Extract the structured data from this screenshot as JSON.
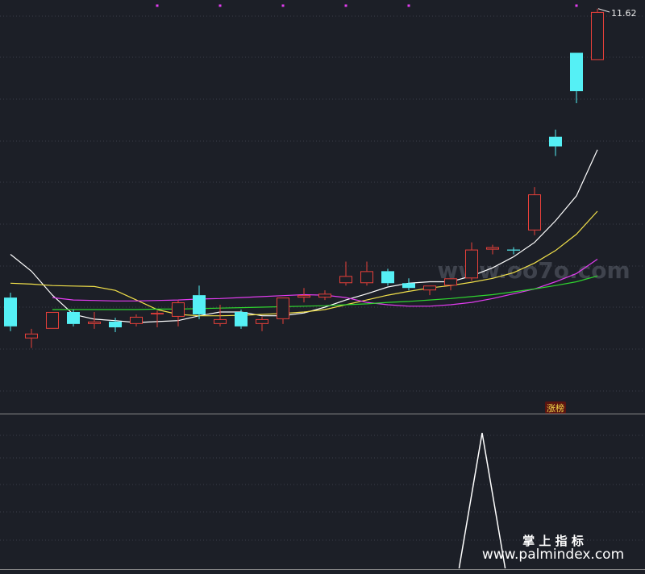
{
  "colors": {
    "background": "#1c1f27",
    "grid": "#3a3e4a",
    "separator": "#8a8a8a",
    "up_candle": "#e8403a",
    "down_candle": "#55f0f5",
    "ma_white": "#ffffff",
    "ma_yellow": "#f2e14a",
    "ma_magenta": "#e23cf0",
    "ma_green": "#2fd62f",
    "indicator_line": "#ffffff",
    "marker_dots": "#e23cf0",
    "badge_bg": "#5a1410",
    "badge_text": "#f4d94a"
  },
  "chart_data": [
    {
      "type": "candlestick",
      "panel": "price",
      "ylim": [
        3.2,
        11.8
      ],
      "max_label": "11.62",
      "candles": [
        {
          "o": 5.6,
          "h": 5.7,
          "l": 4.9,
          "c": 5.0
        },
        {
          "o": 4.75,
          "h": 4.95,
          "l": 4.55,
          "c": 4.85
        },
        {
          "o": 4.95,
          "h": 5.3,
          "l": 4.95,
          "c": 5.3
        },
        {
          "o": 5.3,
          "h": 5.35,
          "l": 5.0,
          "c": 5.05
        },
        {
          "o": 5.05,
          "h": 5.3,
          "l": 4.95,
          "c": 5.1
        },
        {
          "o": 5.1,
          "h": 5.18,
          "l": 4.88,
          "c": 4.98
        },
        {
          "o": 5.05,
          "h": 5.25,
          "l": 5.0,
          "c": 5.2
        },
        {
          "o": 5.25,
          "h": 5.32,
          "l": 4.98,
          "c": 5.28
        },
        {
          "o": 5.2,
          "h": 5.55,
          "l": 5.0,
          "c": 5.5
        },
        {
          "o": 5.65,
          "h": 5.85,
          "l": 5.15,
          "c": 5.25
        },
        {
          "o": 5.05,
          "h": 5.45,
          "l": 5.0,
          "c": 5.15
        },
        {
          "o": 5.3,
          "h": 5.35,
          "l": 4.95,
          "c": 5.0
        },
        {
          "o": 5.05,
          "h": 5.2,
          "l": 4.9,
          "c": 5.15
        },
        {
          "o": 5.15,
          "h": 5.6,
          "l": 5.05,
          "c": 5.6
        },
        {
          "o": 5.6,
          "h": 5.8,
          "l": 5.5,
          "c": 5.65
        },
        {
          "o": 5.6,
          "h": 5.75,
          "l": 5.55,
          "c": 5.68
        },
        {
          "o": 5.9,
          "h": 6.35,
          "l": 5.85,
          "c": 6.05
        },
        {
          "o": 5.9,
          "h": 6.35,
          "l": 5.85,
          "c": 6.15
        },
        {
          "o": 6.15,
          "h": 6.2,
          "l": 5.85,
          "c": 5.9
        },
        {
          "o": 5.9,
          "h": 6.0,
          "l": 5.75,
          "c": 5.8
        },
        {
          "o": 5.75,
          "h": 5.85,
          "l": 5.65,
          "c": 5.85
        },
        {
          "o": 5.85,
          "h": 6.0,
          "l": 5.75,
          "c": 6.0
        },
        {
          "o": 6.0,
          "h": 6.75,
          "l": 5.95,
          "c": 6.6
        },
        {
          "o": 6.6,
          "h": 6.7,
          "l": 6.5,
          "c": 6.65
        },
        {
          "o": 6.6,
          "h": 6.65,
          "l": 6.5,
          "c": 6.58
        },
        {
          "o": 7.0,
          "h": 7.9,
          "l": 6.9,
          "c": 7.75
        },
        {
          "o": 8.95,
          "h": 9.1,
          "l": 8.55,
          "c": 8.75
        },
        {
          "o": 10.7,
          "h": 10.7,
          "l": 9.65,
          "c": 9.9
        },
        {
          "o": 10.55,
          "h": 11.62,
          "l": 10.55,
          "c": 11.55
        }
      ],
      "ma_series": [
        {
          "color_key": "ma_white",
          "values": [
            6.5,
            6.15,
            5.65,
            5.25,
            5.15,
            5.12,
            5.08,
            5.1,
            5.12,
            5.22,
            5.3,
            5.3,
            5.22,
            5.22,
            5.28,
            5.4,
            5.55,
            5.68,
            5.82,
            5.9,
            5.93,
            5.93,
            6.05,
            6.22,
            6.45,
            6.75,
            7.2,
            7.72,
            8.68
          ]
        },
        {
          "color_key": "ma_yellow",
          "values": [
            5.9,
            5.88,
            5.85,
            5.84,
            5.83,
            5.75,
            5.55,
            5.35,
            5.25,
            5.22,
            5.22,
            5.23,
            5.25,
            5.27,
            5.3,
            5.35,
            5.45,
            5.55,
            5.65,
            5.73,
            5.8,
            5.85,
            5.92,
            6.0,
            6.12,
            6.32,
            6.58,
            6.92,
            7.4
          ]
        },
        {
          "color_key": "ma_magenta",
          "values": [
            null,
            null,
            5.6,
            5.55,
            5.54,
            5.53,
            5.53,
            5.54,
            5.55,
            5.57,
            5.58,
            5.6,
            5.62,
            5.64,
            5.66,
            5.65,
            5.6,
            5.5,
            5.45,
            5.42,
            5.42,
            5.45,
            5.5,
            5.58,
            5.68,
            5.78,
            5.93,
            6.1,
            6.4
          ]
        },
        {
          "color_key": "ma_green",
          "values": [
            null,
            null,
            5.35,
            5.35,
            5.35,
            5.35,
            5.35,
            5.36,
            5.36,
            5.37,
            5.38,
            5.39,
            5.4,
            5.41,
            5.42,
            5.43,
            5.45,
            5.47,
            5.5,
            5.52,
            5.55,
            5.58,
            5.62,
            5.66,
            5.72,
            5.78,
            5.85,
            5.93,
            6.05
          ]
        }
      ],
      "marker_dots": [
        7,
        10,
        13,
        16,
        19,
        27
      ]
    },
    {
      "type": "line",
      "panel": "indicator",
      "ylim": [
        0,
        1
      ],
      "segments": [
        {
          "x": [
            21.4,
            22.5,
            23.6
          ],
          "y": [
            0,
            1,
            0
          ]
        }
      ],
      "badge": "涨榜",
      "badge_index": 26
    }
  ],
  "watermarks": {
    "center": "www.oo7o.com",
    "cn_title": "掌 上 指 标",
    "url": "www.palmindex.com"
  }
}
